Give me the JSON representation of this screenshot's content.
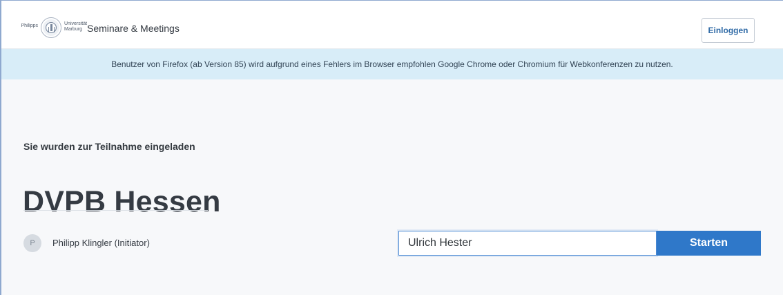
{
  "header": {
    "logo_left_text": "Philipps",
    "logo_right_text": "Universität Marburg",
    "site_title": "Seminare & Meetings",
    "login_label": "Einloggen"
  },
  "notice": {
    "text": "Benutzer von Firefox (ab Version 85) wird aufgrund eines Fehlers im Browser empfohlen Google Chrome oder Chromium für Webkonferenzen zu nutzen."
  },
  "room": {
    "invite_label": "Sie wurden zur Teilnahme eingeladen",
    "name": "DVPB Hessen",
    "owner_initial": "P",
    "owner_name": "Philipp Klingler (Initiator)"
  },
  "join_form": {
    "name_value": "Ulrich Hester",
    "start_label": "Starten"
  },
  "icons": {
    "university_seal": "university-seal-icon"
  }
}
